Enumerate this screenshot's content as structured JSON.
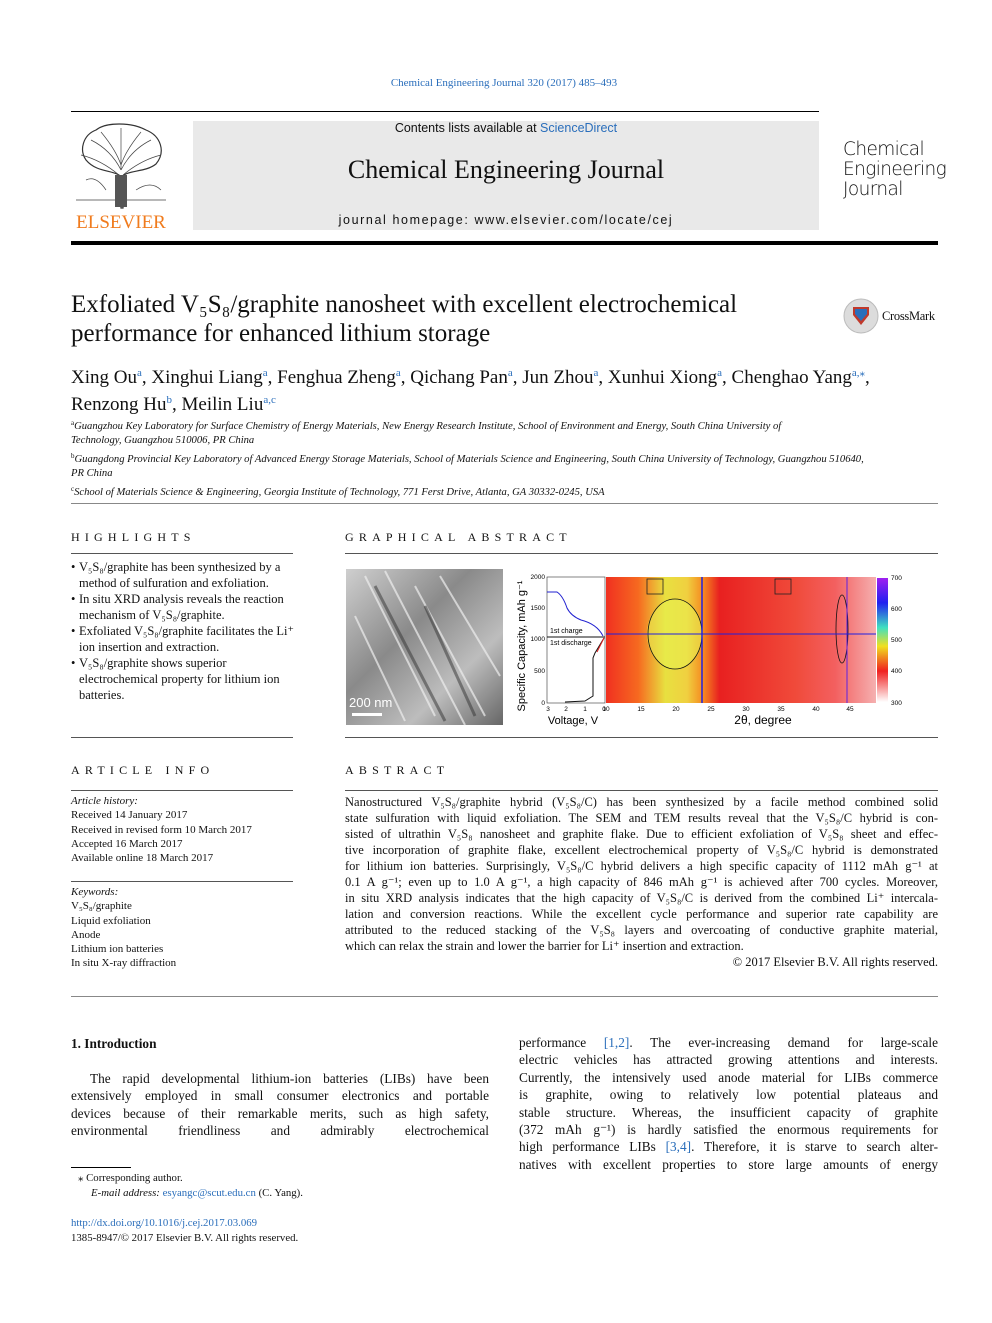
{
  "header": {
    "journal_ref": "Chemical Engineering Journal 320 (2017) 485–493",
    "contents_prefix": "Contents lists available at ",
    "contents_link": "ScienceDirect",
    "journal_title": "Chemical Engineering Journal",
    "homepage": "journal homepage: www.elsevier.com/locate/cej",
    "publisher_logo": "ELSEVIER",
    "journal_logo": [
      "Chemical",
      "Engineering",
      "Journal"
    ],
    "crossmark": "CrossMark"
  },
  "article": {
    "title_lines": [
      "Exfoliated V₅S₈/graphite nanosheet with excellent electrochemical",
      "performance for enhanced lithium storage"
    ],
    "authors": [
      {
        "name": "Xing Ou",
        "aff": "a"
      },
      {
        "name": "Xinghui Liang",
        "aff": "a"
      },
      {
        "name": "Fenghua Zheng",
        "aff": "a"
      },
      {
        "name": "Qichang Pan",
        "aff": "a"
      },
      {
        "name": "Jun Zhou",
        "aff": "a"
      },
      {
        "name": "Xunhui Xiong",
        "aff": "a"
      },
      {
        "name": "Chenghao Yang",
        "aff": "a,⁎"
      },
      {
        "name": "Renzong Hu",
        "aff": "b"
      },
      {
        "name": "Meilin Liu",
        "aff": "a,c"
      }
    ],
    "affiliations": [
      {
        "mark": "a",
        "lines": [
          "Guangzhou Key Laboratory for Surface Chemistry of Energy Materials, New Energy Research Institute, School of Environment and Energy, South China University of",
          "Technology, Guangzhou 510006, PR China"
        ]
      },
      {
        "mark": "b",
        "lines": [
          "Guangdong Provincial Key Laboratory of Advanced Energy Storage Materials, School of Materials Science and Engineering, South China University of Technology, Guangzhou 510640,",
          "PR China"
        ]
      },
      {
        "mark": "c",
        "lines": [
          "School of Materials Science & Engineering, Georgia Institute of Technology, 771 Ferst Drive, Atlanta, GA 30332-0245, USA"
        ]
      }
    ]
  },
  "highlights": {
    "heading": "HIGHLIGHTS",
    "items": [
      "V₅S₈/graphite has been synthesized by a method of sulfuration and exfoliation.",
      "In situ XRD analysis reveals the reaction mechanism of V₅S₈/graphite.",
      "Exfoliated V₅S₈/graphite facilitates the Li⁺ ion insertion and extraction.",
      "V₅S₈/graphite shows superior electrochemical property for lithium ion batteries."
    ]
  },
  "article_info": {
    "heading": "ARTICLE INFO",
    "history_label": "Article history:",
    "history": [
      "Received 14 January 2017",
      "Received in revised form 10 March 2017",
      "Accepted 16 March 2017",
      "Available online 18 March 2017"
    ],
    "keywords_label": "Keywords:",
    "keywords": [
      "V₅S₈/graphite",
      "Liquid exfoliation",
      "Anode",
      "Lithium ion batteries",
      "In situ X-ray diffraction"
    ]
  },
  "graphical_abstract": {
    "heading": "GRAPHICAL ABSTRACT",
    "scale_bar": "200 nm",
    "ylabel": "Specific Capacity, mAh g⁻¹",
    "yticks": [
      "0",
      "500",
      "1000",
      "1500",
      "2000"
    ],
    "voltage_xlabel": "Voltage, V",
    "voltage_xticks": [
      "3",
      "2",
      "1",
      "0"
    ],
    "charge_label": "1st charge",
    "discharge_label": "1st discharge",
    "xrd_xlabel": "2θ, degree",
    "xrd_xticks": [
      "10",
      "15",
      "20",
      "25",
      "30",
      "35",
      "40",
      "45"
    ],
    "colorbar_ticks": [
      "300",
      "400",
      "500",
      "600",
      "700"
    ]
  },
  "abstract": {
    "heading": "ABSTRACT",
    "lines": [
      "Nanostructured V₅S₈/graphite hybrid (V₅S₈/C) has been synthesized by a facile method combined solid",
      "state sulfuration with liquid exfoliation. The SEM and TEM results reveal that the V₅S₈/C hybrid is con-",
      "sisted of ultrathin V₅S₈ nanosheet and graphite flake. Due to efficient exfoliation of V₅S₈ sheet and effec-",
      "tive incorporation of graphite flake, excellent electrochemical property of V₅S₈/C hybrid is demonstrated",
      "for lithium ion batteries. Surprisingly, V₅S₈/C hybrid delivers a high specific capacity of 1112 mAh g⁻¹ at",
      "0.1 A g⁻¹; even up to 1.0 A g⁻¹, a high capacity of 846 mAh g⁻¹ is achieved after 700 cycles. Moreover,",
      "in situ XRD analysis indicates that the high capacity of V₅S₈/C is derived from the combined Li⁺ intercala-",
      "lation and conversion reactions. While the excellent cycle performance and superior rate capability are",
      "attributed to the reduced stacking of the V₅S₈ layers and overcoating of conductive graphite material,"
    ],
    "last_line": "which can relax the strain and lower the barrier for Li⁺ insertion and extraction.",
    "copyright": "© 2017 Elsevier B.V. All rights reserved."
  },
  "intro": {
    "heading": "1. Introduction",
    "col1_lines": [
      "The rapid developmental lithium-ion batteries (LIBs) have been",
      "extensively employed in small consumer electronics and portable",
      "devices because of their remarkable merits, such as high safety,",
      "environmental friendliness and admirably electrochemical"
    ],
    "col2_line1": {
      "pre": "performance ",
      "ref": "[1,2]",
      "post": ". The ever-increasing demand for large-scale"
    },
    "col2_lines": [
      "electric vehicles has attracted growing attentions and interests.",
      "Currently, the intensively used anode material for LIBs commerce",
      "is graphite, owing to relatively low potential plateaus and",
      "stable structure. Whereas, the insufficient capacity of graphite",
      "(372 mAh g⁻¹) is hardly satisfied the enormous requirements for"
    ],
    "col2_line7": {
      "pre": "high performance LIBs ",
      "ref": "[3,4]",
      "post": ". Therefore, it is starve to search alter-"
    },
    "col2_last": "natives with excellent properties to store large amounts of energy"
  },
  "footnotes": {
    "corresponding": "⁎  Corresponding author.",
    "email_label": "E-mail address: ",
    "email": "esyangc@scut.edu.cn",
    "email_suffix": " (C. Yang).",
    "doi": "http://dx.doi.org/10.1016/j.cej.2017.03.069",
    "issn": "1385-8947/© 2017 Elsevier B.V. All rights reserved."
  },
  "colors": {
    "link": "#2a6ebb",
    "header_box": "#e9e9e9",
    "elsevier_orange": "#f07b1d"
  }
}
